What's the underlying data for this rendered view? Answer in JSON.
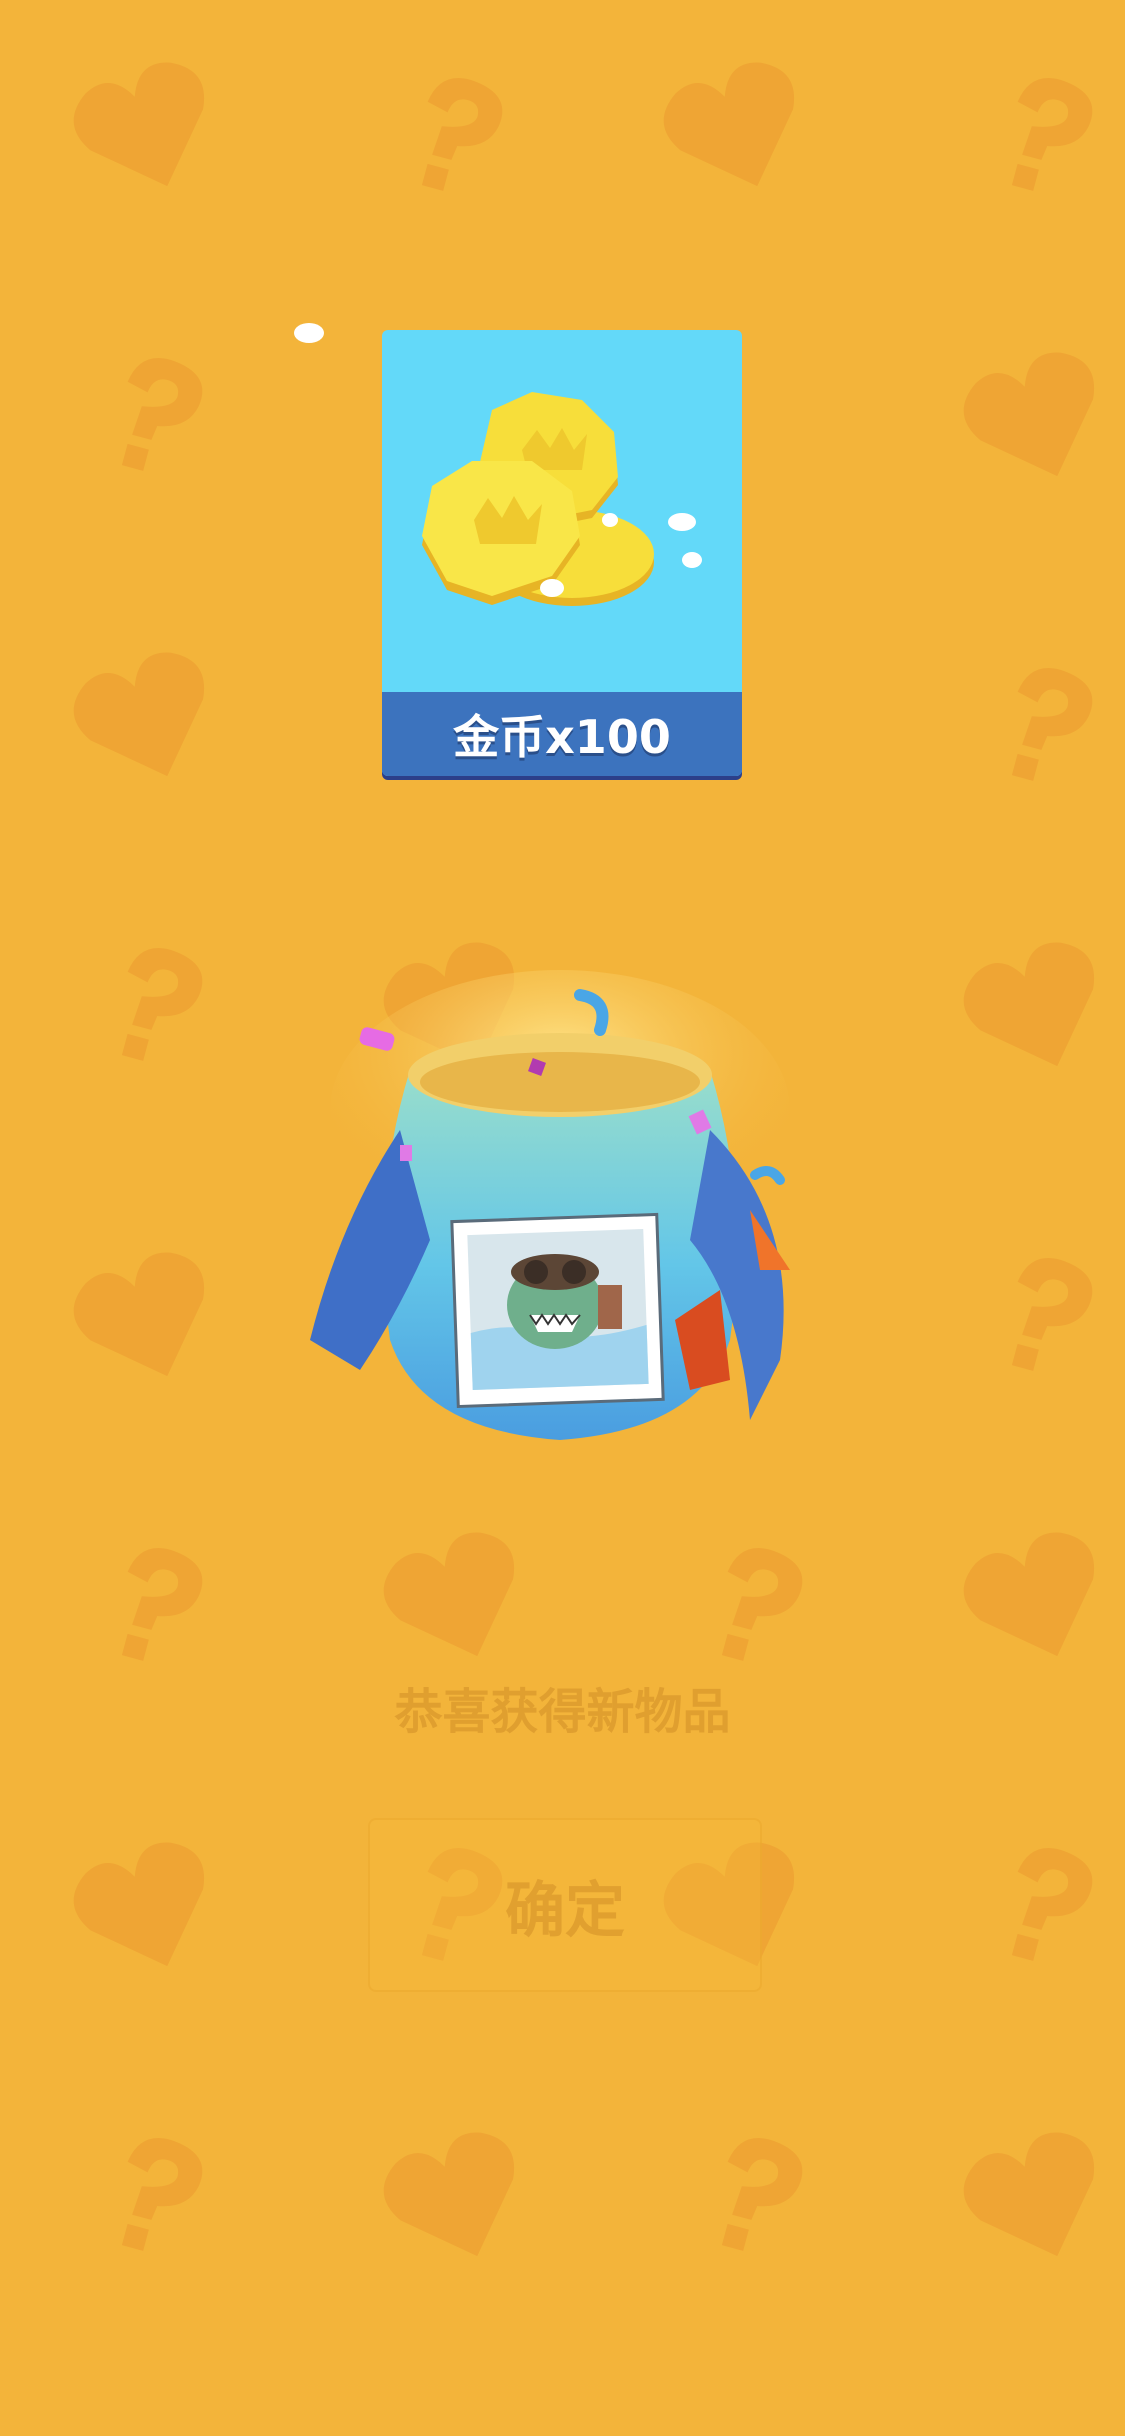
{
  "colors": {
    "background": "#F3B43A",
    "pattern": "#EFA534",
    "card_background": "#63D9F9",
    "card_label_bar": "#3C73BE",
    "coin": "#F7DE3A"
  },
  "reward": {
    "label": "金币x100",
    "icon": "gold-coins-icon"
  },
  "bag": {
    "icon": "mystery-bag-icon",
    "sticker": "shark-sticker"
  },
  "congrats_text": "恭喜获得新物品",
  "confirm_label": "确定"
}
